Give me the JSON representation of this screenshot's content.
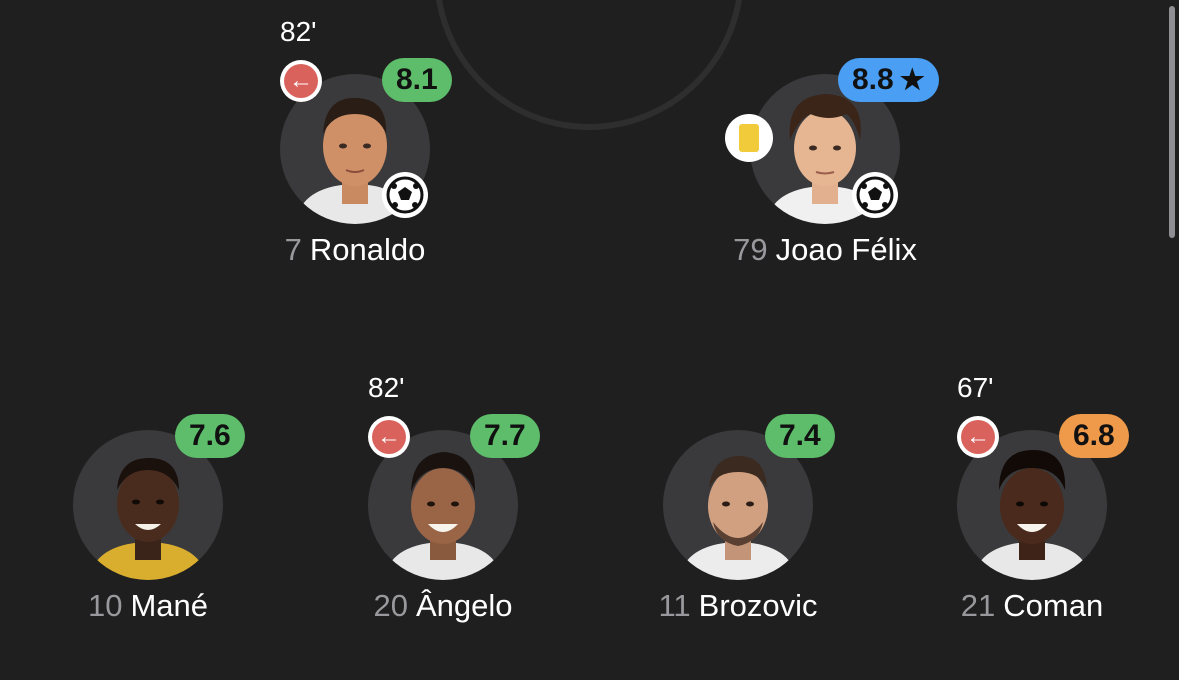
{
  "players": [
    {
      "number": "7",
      "name": "Ronaldo",
      "rating": "8.1",
      "rating_color": "#5ebd6a",
      "sub_minute": "82'",
      "substituted": true,
      "goal": true,
      "yellow_card": false,
      "star": false
    },
    {
      "number": "79",
      "name": "Joao Félix",
      "rating": "8.8",
      "rating_color": "#4a9ff5",
      "sub_minute": "",
      "substituted": false,
      "goal": true,
      "yellow_card": true,
      "star": true
    },
    {
      "number": "10",
      "name": "Mané",
      "rating": "7.6",
      "rating_color": "#5ebd6a",
      "sub_minute": "",
      "substituted": false,
      "goal": false,
      "yellow_card": false,
      "star": false
    },
    {
      "number": "20",
      "name": "Ângelo",
      "rating": "7.7",
      "rating_color": "#5ebd6a",
      "sub_minute": "82'",
      "substituted": true,
      "goal": false,
      "yellow_card": false,
      "star": false
    },
    {
      "number": "11",
      "name": "Brozovic",
      "rating": "7.4",
      "rating_color": "#5ebd6a",
      "sub_minute": "",
      "substituted": false,
      "goal": false,
      "yellow_card": false,
      "star": false
    },
    {
      "number": "21",
      "name": "Coman",
      "rating": "6.8",
      "rating_color": "#ef9a4a",
      "sub_minute": "67'",
      "substituted": true,
      "goal": false,
      "yellow_card": false,
      "star": false
    }
  ],
  "icons": {
    "substitution": "arrow-left-icon",
    "goal": "soccer-ball-icon",
    "booking": "yellow-card-icon",
    "best_player": "star-icon"
  },
  "glyphs": {
    "sub_arrow": "←",
    "star": "★"
  }
}
